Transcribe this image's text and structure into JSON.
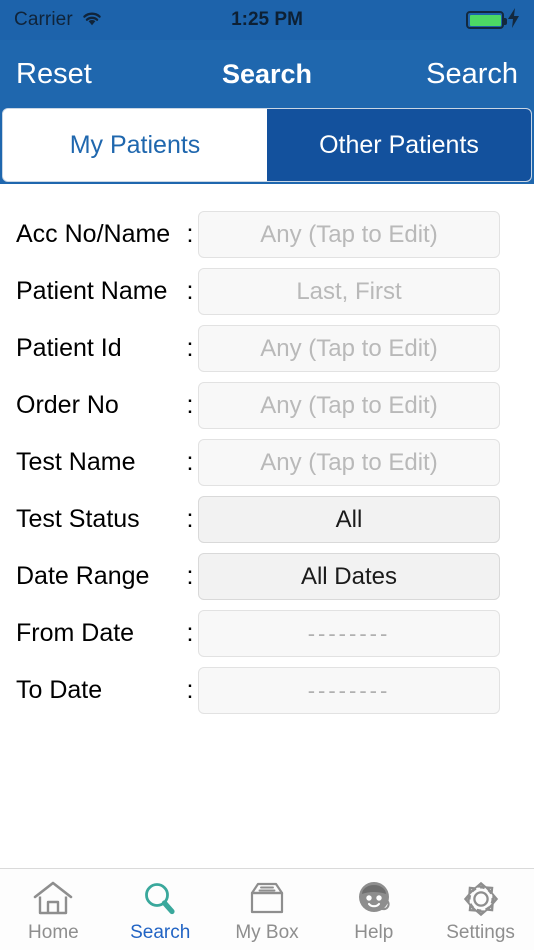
{
  "status_bar": {
    "carrier": "Carrier",
    "wifi_icon": "wifi-icon",
    "time": "1:25 PM",
    "battery_icon": "battery-full-icon",
    "charging_icon": "lightning-bolt-icon"
  },
  "nav_bar": {
    "left_button": "Reset",
    "title": "Search",
    "right_button": "Search"
  },
  "segmented_control": {
    "segments": [
      {
        "label": "My Patients",
        "selected": false
      },
      {
        "label": "Other Patients",
        "selected": true
      }
    ]
  },
  "form": {
    "separator": ":",
    "rows": [
      {
        "label": "Acc No/Name",
        "value": "Any (Tap to Edit)",
        "filled": false,
        "dashes": false
      },
      {
        "label": "Patient Name",
        "value": "Last, First",
        "filled": false,
        "dashes": false
      },
      {
        "label": "Patient Id",
        "value": "Any (Tap to Edit)",
        "filled": false,
        "dashes": false
      },
      {
        "label": "Order No",
        "value": "Any (Tap to Edit)",
        "filled": false,
        "dashes": false
      },
      {
        "label": "Test Name",
        "value": "Any (Tap to Edit)",
        "filled": false,
        "dashes": false
      },
      {
        "label": "Test Status",
        "value": "All",
        "filled": true,
        "dashes": false
      },
      {
        "label": "Date Range",
        "value": "All Dates",
        "filled": true,
        "dashes": false
      },
      {
        "label": "From Date",
        "value": "--------",
        "filled": false,
        "dashes": true
      },
      {
        "label": "To Date",
        "value": "--------",
        "filled": false,
        "dashes": true
      }
    ]
  },
  "tab_bar": {
    "tabs": [
      {
        "label": "Home",
        "icon": "home-icon",
        "active": false
      },
      {
        "label": "Search",
        "icon": "search-icon",
        "active": true
      },
      {
        "label": "My Box",
        "icon": "inbox-icon",
        "active": false
      },
      {
        "label": "Help",
        "icon": "support-agent-icon",
        "active": false
      },
      {
        "label": "Settings",
        "icon": "gear-icon",
        "active": false
      }
    ]
  },
  "colors": {
    "nav_bar_blue": "#1f67ae",
    "selected_segment_blue": "#13519d",
    "active_tab_label_blue": "#2264c4",
    "search_icon_teal": "#3aa89c",
    "inactive_gray": "#8e8e8e",
    "battery_green": "#4cd964"
  }
}
